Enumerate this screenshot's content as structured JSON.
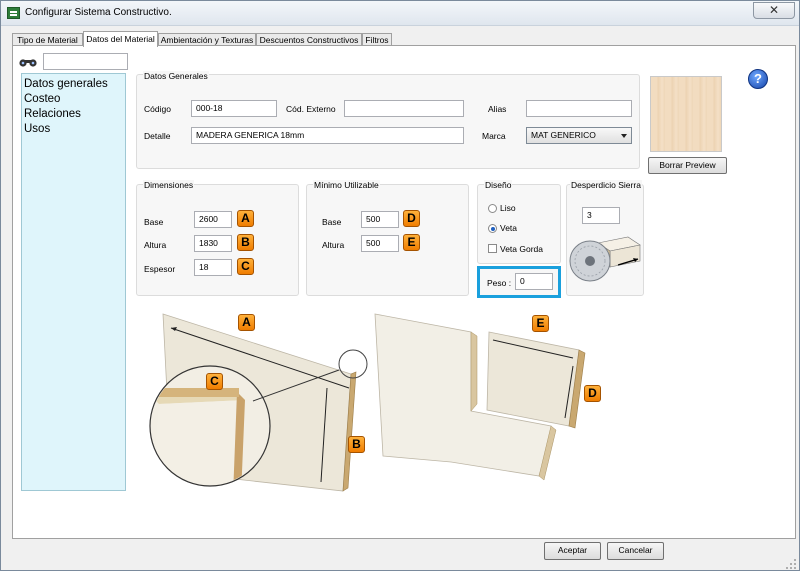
{
  "window": {
    "title": "Configurar Sistema Constructivo.",
    "close_glyph": "✕"
  },
  "tabs": [
    {
      "label": "Tipo de Material"
    },
    {
      "label": "Datos del Material"
    },
    {
      "label": "Ambientación y Texturas"
    },
    {
      "label": "Descuentos Constructivos"
    },
    {
      "label": "Filtros"
    }
  ],
  "search": {
    "value": "",
    "icon": "binoculars-icon"
  },
  "nav": {
    "items": [
      "Datos generales",
      "Costeo",
      "Relaciones",
      "Usos"
    ]
  },
  "datos_generales": {
    "title": "Datos Generales",
    "codigo_label": "Código",
    "codigo_value": "000-18",
    "cod_externo_label": "Cód. Externo",
    "cod_externo_value": "",
    "alias_label": "Alias",
    "alias_value": "",
    "detalle_label": "Detalle",
    "detalle_value": "MADERA GENERICA 18mm",
    "marca_label": "Marca",
    "marca_value": "MAT GENERICO"
  },
  "preview": {
    "button_label": "Borrar Preview",
    "help_glyph": "?"
  },
  "dimensiones": {
    "title": "Dimensiones",
    "base_label": "Base",
    "base_value": "2600",
    "base_badge": "A",
    "altura_label": "Altura",
    "altura_value": "1830",
    "altura_badge": "B",
    "espesor_label": "Espesor",
    "espesor_value": "18",
    "espesor_badge": "C"
  },
  "minimo": {
    "title": "Mínimo Utilizable",
    "base_label": "Base",
    "base_value": "500",
    "base_badge": "D",
    "altura_label": "Altura",
    "altura_value": "500",
    "altura_badge": "E"
  },
  "diseno": {
    "title": "Diseño",
    "liso_label": "Liso",
    "veta_label": "Veta",
    "veta_gorda_label": "Veta Gorda",
    "selected": "Veta",
    "veta_gorda_checked": false
  },
  "peso": {
    "label": "Peso :",
    "value": "0"
  },
  "desperdicio": {
    "title": "Desperdicio Sierra",
    "value": "3"
  },
  "illustration": {
    "badges": [
      "A",
      "B",
      "C",
      "E",
      "D"
    ]
  },
  "footer": {
    "accept_label": "Aceptar",
    "cancel_label": "Cancelar"
  },
  "colors": {
    "accent": "#1aa0dd",
    "badge": "#f39000",
    "nav_bg": "#dff5fb"
  }
}
